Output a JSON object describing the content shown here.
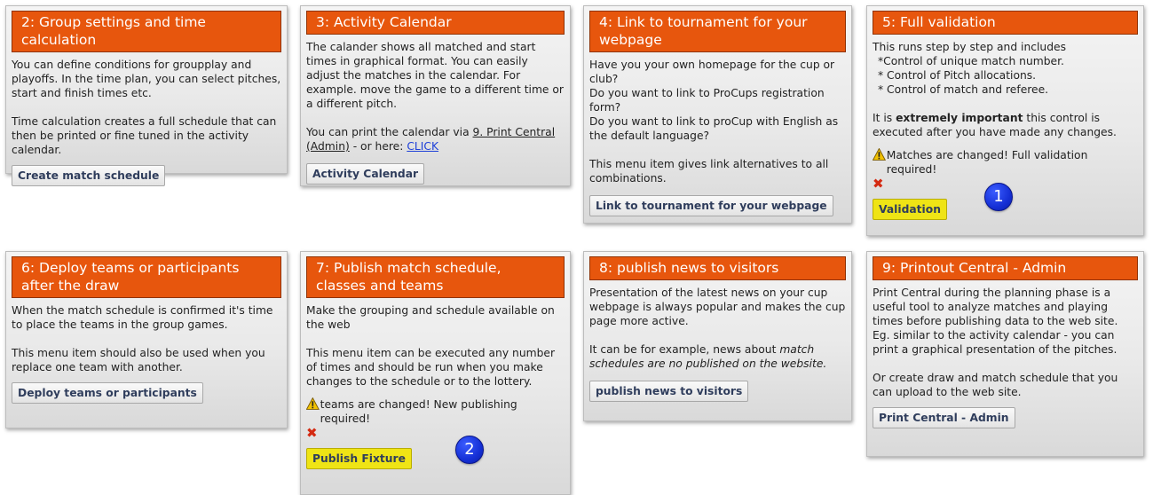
{
  "cards": {
    "c2": {
      "title": "2: Group settings and time calculation",
      "p1": "You can define conditions for groupplay and playoffs. In the time plan, you can select pitches, start and finish times etc.",
      "p2": "Time calculation creates a full schedule that can then be printed or fine tuned in the activity calendar.",
      "button": "Create match schedule"
    },
    "c3": {
      "title": "3: Activity Calendar",
      "p1": "The calander shows all matched and start times in graphical format. You can easily adjust the matches in the calendar. For example. move the game to a different time or a different pitch.",
      "p2_pre": "You can print the calendar via ",
      "p2_link": "9. Print Central (Admin)",
      "p2_mid": " - or here: ",
      "p2_click": "CLICK",
      "button": "Activity Calendar"
    },
    "c4": {
      "title": "4: Link to tournament for your webpage",
      "p1": "Have you your own homepage for the cup or club?",
      "p2": "Do you want to link to ProCups registration form?",
      "p3": "Do you want to link to proCup with English as the default language?",
      "p4": "This menu item gives link alternatives to all combinations.",
      "button": "Link to tournament for your webpage"
    },
    "c5": {
      "title": "5: Full validation",
      "intro": "This runs step by step and includes",
      "b1": "*Control of unique match number.",
      "b2": "* Control of Pitch allocations.",
      "b3": "* Control of match and referee.",
      "imp_pre": "It is ",
      "imp_bold": "extremely important",
      "imp_post": " this control is executed after you have made any changes.",
      "warning": "Matches are changed! Full validation required!",
      "button": "Validation"
    },
    "c6": {
      "title": "6: Deploy teams or participants after the draw",
      "p1": "When the match schedule is confirmed it's time to place the teams in the group games.",
      "p2": "This menu item should also be used when you replace one team with another.",
      "button": "Deploy teams or participants"
    },
    "c7": {
      "title": "7: Publish match schedule, classes and teams",
      "p1": "Make the grouping and schedule available on the web",
      "p2": "This menu item can be executed any number of times and should be run when you make changes to the schedule or to the lottery.",
      "warning": "teams are changed! New publishing required!",
      "button": "Publish Fixture"
    },
    "c8": {
      "title": "8: publish news to visitors",
      "p1": "Presentation of the latest news on your cup webpage is always popular and makes the cup page more active.",
      "p2_pre": "It can be for example, news about ",
      "p2_italic": "match schedules are no published on the website.",
      "button": "publish news to visitors"
    },
    "c9": {
      "title": "9: Printout Central - Admin",
      "p1": "Print Central during the planning phase is a useful tool to analyze matches and playing times before publishing data to the web site. Eg. similar to the activity calendar - you can print a graphical presentation of the pitches.",
      "p2": "Or create draw and match schedule that you can upload to the web site.",
      "button": "Print Central - Admin"
    }
  },
  "markers": {
    "m1": "1",
    "m2": "2"
  },
  "colors": {
    "header": "#e7560d",
    "highlight_button": "#efe415",
    "marker": "#1530d6",
    "error": "#d42a12",
    "warning": "#f2c200"
  },
  "icons": {
    "warning": "warning-icon",
    "error": "close-x-icon"
  }
}
